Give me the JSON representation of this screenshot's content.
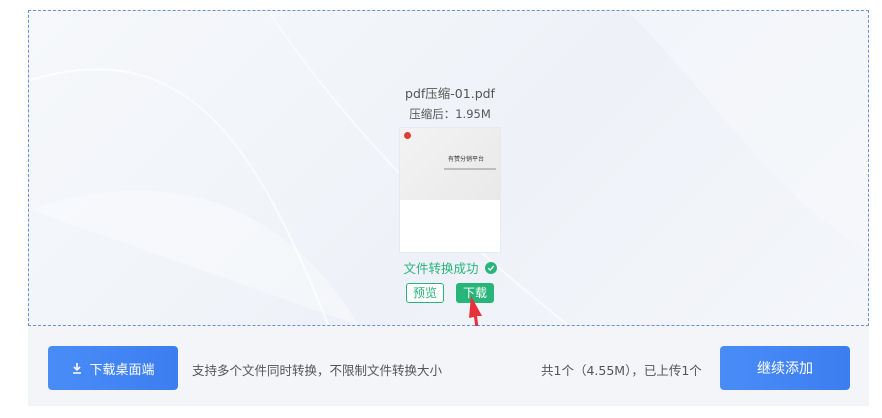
{
  "upload": {
    "file": {
      "name": "pdf压缩-01.pdf",
      "size_text": "压缩后：1.95M",
      "thumbnail_title": "有赞分销平台",
      "status": "文件转换成功",
      "preview_label": "预览",
      "download_label": "下载"
    }
  },
  "footer": {
    "desktop_download_label": "下载桌面端",
    "hint": "支持多个文件同时转换，不限制文件转换大小",
    "summary": "共1个（4.55M），已上传1个",
    "add_more_label": "继续添加"
  },
  "colors": {
    "success": "#27b57a",
    "primary": "#3c7ef0",
    "annotation_arrow": "#e8303a"
  },
  "icons": {
    "status": "check-circle-icon",
    "desktop": "download-arrow-icon"
  }
}
